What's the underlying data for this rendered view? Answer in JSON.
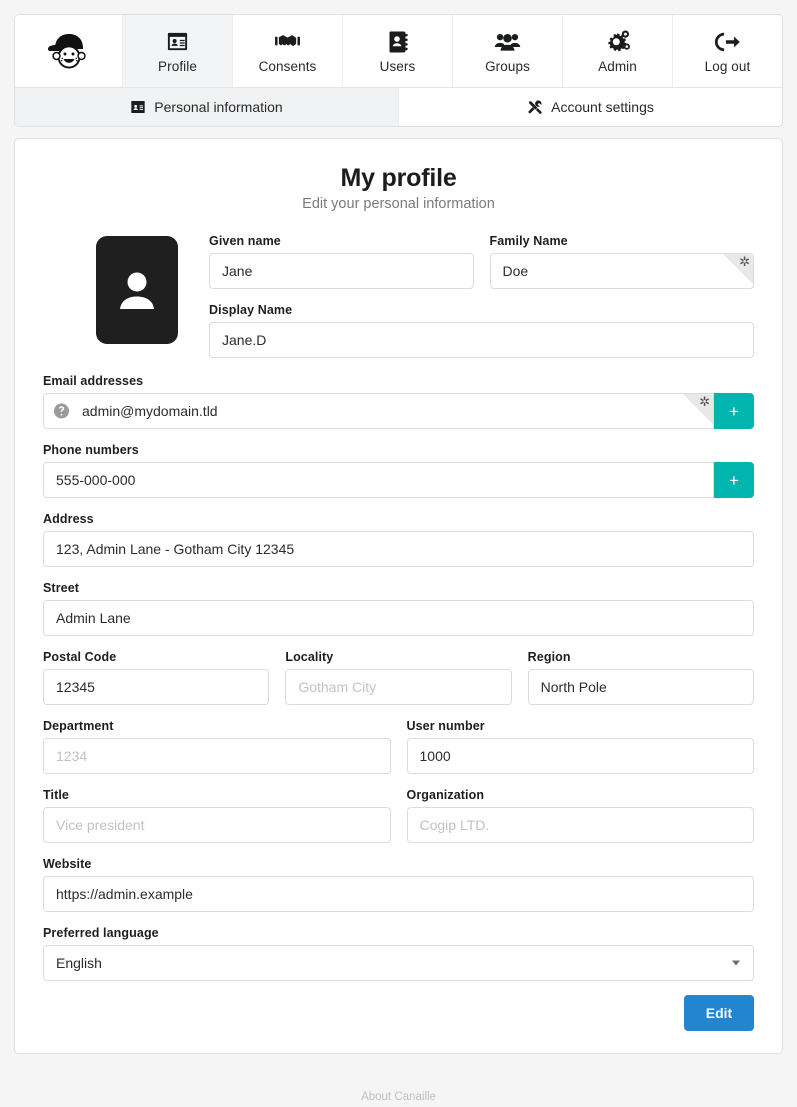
{
  "nav": {
    "brand": {
      "icon": "canaille-logo-icon",
      "label": ""
    },
    "items": [
      {
        "label": "Profile",
        "icon": "id-card-icon",
        "active": true
      },
      {
        "label": "Consents",
        "icon": "handshake-icon",
        "active": false
      },
      {
        "label": "Users",
        "icon": "address-book-icon",
        "active": false
      },
      {
        "label": "Groups",
        "icon": "users-icon",
        "active": false
      },
      {
        "label": "Admin",
        "icon": "cogs-icon",
        "active": false
      },
      {
        "label": "Log out",
        "icon": "sign-out-icon",
        "active": false
      }
    ],
    "subtabs": [
      {
        "label": "Personal information",
        "icon": "id-card-icon",
        "active": true
      },
      {
        "label": "Account settings",
        "icon": "tools-icon",
        "active": false
      }
    ]
  },
  "header": {
    "title": "My profile",
    "subtitle": "Edit your personal information"
  },
  "avatar": {
    "icon": "user-silhouette-icon"
  },
  "form": {
    "given_name": {
      "label": "Given name",
      "value": "Jane",
      "placeholder": ""
    },
    "family_name": {
      "label": "Family Name",
      "value": "Doe",
      "placeholder": "",
      "required_mark": "✲"
    },
    "display_name": {
      "label": "Display Name",
      "value": "Jane.D",
      "placeholder": ""
    },
    "emails": {
      "label": "Email addresses",
      "value": "admin@mydomain.tld",
      "placeholder": "",
      "prefix_icon": "question-circle-icon",
      "required_mark": "✲",
      "add_label": "+"
    },
    "phones": {
      "label": "Phone numbers",
      "value": "555-000-000",
      "placeholder": "",
      "add_label": "+"
    },
    "address": {
      "label": "Address",
      "value": "123, Admin Lane - Gotham City 12345",
      "placeholder": ""
    },
    "street": {
      "label": "Street",
      "value": "Admin Lane",
      "placeholder": ""
    },
    "postal_code": {
      "label": "Postal Code",
      "value": "12345",
      "placeholder": ""
    },
    "locality": {
      "label": "Locality",
      "value": "",
      "placeholder": "Gotham City"
    },
    "region": {
      "label": "Region",
      "value": "North Pole",
      "placeholder": ""
    },
    "department": {
      "label": "Department",
      "value": "",
      "placeholder": "1234"
    },
    "user_number": {
      "label": "User number",
      "value": "1000",
      "placeholder": ""
    },
    "title": {
      "label": "Title",
      "value": "",
      "placeholder": "Vice president"
    },
    "organization": {
      "label": "Organization",
      "value": "",
      "placeholder": "Cogip LTD."
    },
    "website": {
      "label": "Website",
      "value": "https://admin.example",
      "placeholder": ""
    },
    "language": {
      "label": "Preferred language",
      "value": "English",
      "options": [
        "English"
      ]
    }
  },
  "actions": {
    "edit_label": "Edit"
  },
  "footer": {
    "about_label": "About Canaille"
  },
  "colors": {
    "accent_add": "#00b5ad",
    "accent_primary": "#2185d0",
    "page_bg": "#f5f5f5",
    "text": "#1b1c1d",
    "muted": "#7b7b7b"
  }
}
